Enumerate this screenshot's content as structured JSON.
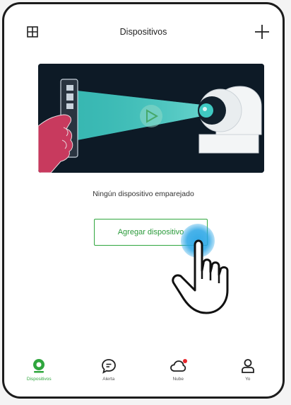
{
  "header": {
    "title": "Dispositivos",
    "grid_icon": "grid-icon",
    "add_icon": "plus-icon"
  },
  "main": {
    "empty_message": "Ningún dispositivo emparejado",
    "add_button_label": "Agregar dispositivo",
    "illustration_icon": "phone-scanning-camera-illustration"
  },
  "bottom_nav": {
    "items": [
      {
        "label": "Dispositivos",
        "icon": "camera-icon",
        "active": true
      },
      {
        "label": "Alerta",
        "icon": "message-icon",
        "active": false
      },
      {
        "label": "Nube",
        "icon": "cloud-icon",
        "active": false,
        "badge": true
      },
      {
        "label": "Yo",
        "icon": "user-icon",
        "active": false
      }
    ]
  },
  "colors": {
    "accent": "#2fa63e",
    "badge": "#e8262c",
    "illustration_bg": "#0d1a26",
    "beam": "#3fc9c2",
    "tap_highlight": "#28a5e6"
  }
}
